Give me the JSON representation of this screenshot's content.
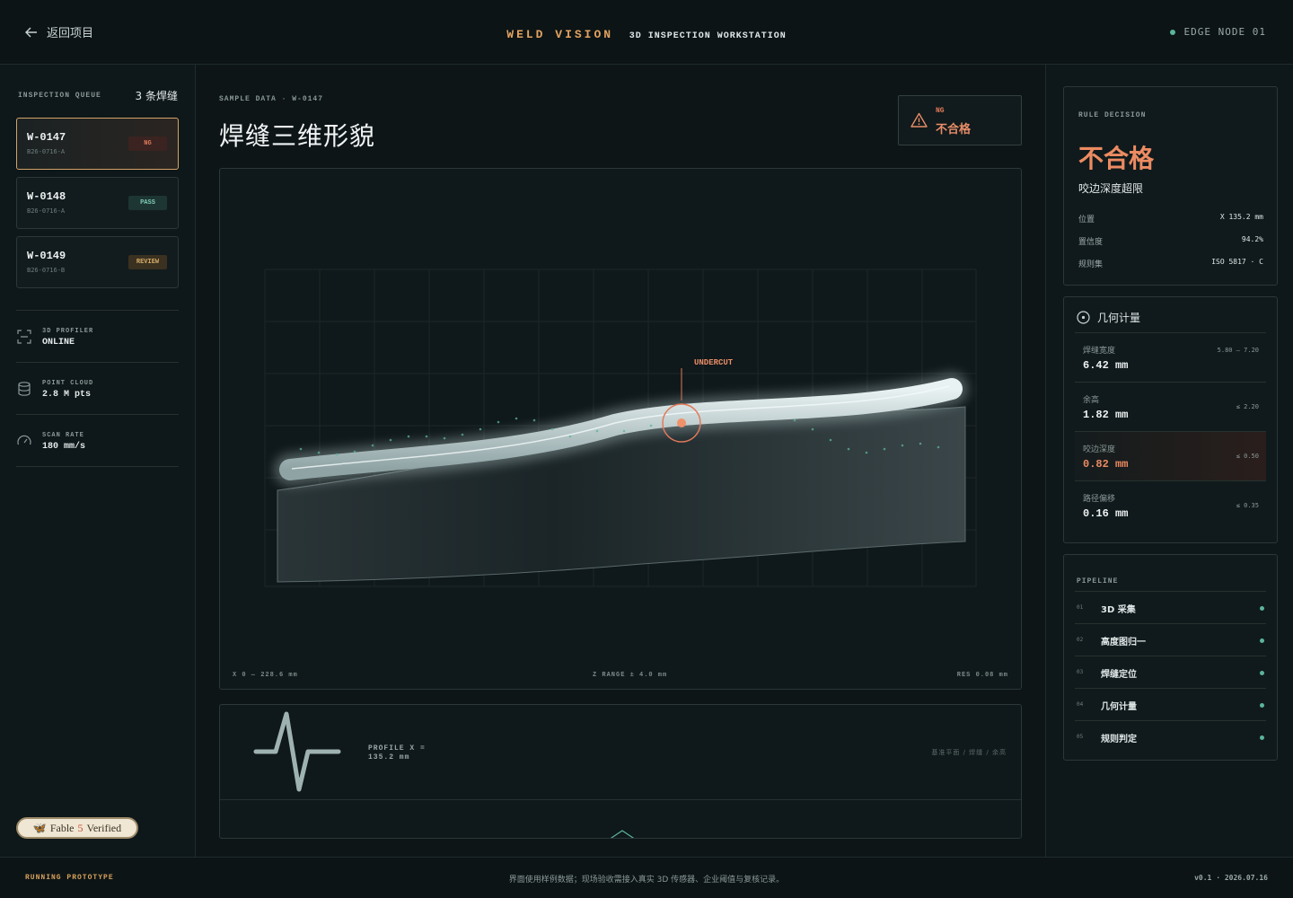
{
  "header": {
    "back_label": "返回项目",
    "brand": "WELD VISION",
    "subtitle": "3D INSPECTION WORKSTATION",
    "node": "EDGE NODE 01"
  },
  "sidebar": {
    "queue_title": "INSPECTION QUEUE",
    "queue_count": "3 条焊缝",
    "queue": [
      {
        "id": "W-0147",
        "batch": "B26-0716-A",
        "status": "NG"
      },
      {
        "id": "W-0148",
        "batch": "B26-0716-A",
        "status": "PASS"
      },
      {
        "id": "W-0149",
        "batch": "B26-0716-B",
        "status": "REVIEW"
      }
    ],
    "stats": [
      {
        "label": "3D PROFILER",
        "value": "ONLINE",
        "icon": "scan-icon"
      },
      {
        "label": "POINT CLOUD",
        "value": "2.8 M pts",
        "icon": "database-icon"
      },
      {
        "label": "SCAN RATE",
        "value": "180 mm/s",
        "icon": "gauge-icon"
      }
    ],
    "fable": {
      "pre": "Fable",
      "num": "5",
      "post": "Verified"
    }
  },
  "main": {
    "sample_label": "SAMPLE DATA · W-0147",
    "title": "焊缝三维形貌",
    "ng_code": "NG",
    "ng_text": "不合格",
    "defect_label": "UNDERCUT",
    "foot_left": "X 0 — 228.6 mm",
    "foot_center": "Z RANGE ± 4.0 mm",
    "foot_right": "RES 0.08 mm",
    "profile_label": "PROFILE X = 135.2 mm",
    "profile_legend": "基准平面 / 焊缝 / 余高"
  },
  "decision": {
    "title": "RULE DECISION",
    "result": "不合格",
    "reason": "咬边深度超限",
    "rows": [
      {
        "k": "位置",
        "v": "X 135.2 mm"
      },
      {
        "k": "置信度",
        "v": "94.2%"
      },
      {
        "k": "规则集",
        "v": "ISO 5817 · C"
      }
    ]
  },
  "metrics": {
    "title": "几何计量",
    "rows": [
      {
        "label": "焊缝宽度",
        "value": "6.42 mm",
        "range": "5.80 – 7.20",
        "alert": false
      },
      {
        "label": "余高",
        "value": "1.82 mm",
        "range": "≤ 2.20",
        "alert": false
      },
      {
        "label": "咬边深度",
        "value": "0.82 mm",
        "range": "≤ 0.50",
        "alert": true
      },
      {
        "label": "路径偏移",
        "value": "0.16 mm",
        "range": "≤ 0.35",
        "alert": false
      }
    ]
  },
  "pipeline": {
    "title": "PIPELINE",
    "steps": [
      {
        "n": "01",
        "label": "3D 采集"
      },
      {
        "n": "02",
        "label": "高度图归一"
      },
      {
        "n": "03",
        "label": "焊缝定位"
      },
      {
        "n": "04",
        "label": "几何计量"
      },
      {
        "n": "05",
        "label": "规则判定"
      }
    ]
  },
  "footer": {
    "left": "RUNNING PROTOTYPE",
    "center": "界面使用样例数据；现场验收需接入真实 3D 传感器、企业阈值与复核记录。",
    "right": "v0.1 · 2026.07.16"
  },
  "colors": {
    "accent": "#e3a25f",
    "ng": "#ec8b62",
    "ok": "#5bb49a"
  }
}
